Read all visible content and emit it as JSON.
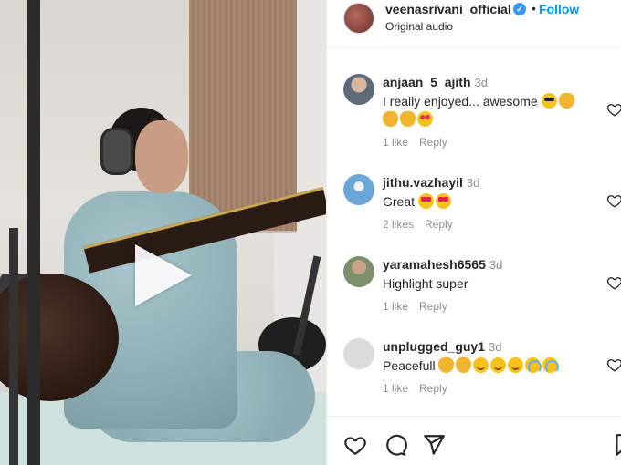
{
  "post": {
    "username": "veenasrivani_official",
    "verified_mark": "✓",
    "separator": "•",
    "follow_label": "Follow",
    "audio_label": "Original audio"
  },
  "comments": [
    {
      "username": "anjaan_5_ajith",
      "time": "3d",
      "text": "I really enjoyed... awesome",
      "emojis": [
        "smiling-face-with-sunglasses",
        "clapping-hands",
        "clapping-hands",
        "clapping-hands",
        "star-struck"
      ],
      "likes": "1 like",
      "reply_label": "Reply"
    },
    {
      "username": "jithu.vazhayil",
      "time": "3d",
      "text": "Great",
      "emojis": [
        "heart-eyes",
        "heart-eyes"
      ],
      "likes": "2 likes",
      "reply_label": "Reply"
    },
    {
      "username": "yaramahesh6565",
      "time": "3d",
      "text": "Highlight super",
      "emojis": [],
      "likes": "1 like",
      "reply_label": "Reply"
    },
    {
      "username": "unplugged_guy1",
      "time": "3d",
      "text": "Peacefull",
      "emojis": [
        "clapping-hands",
        "clapping-hands",
        "smiling-face",
        "smiling-face",
        "smiling-face",
        "grinning-face-with-sweat",
        "grinning-face-with-sweat"
      ],
      "likes": "1 like",
      "reply_label": "Reply"
    }
  ],
  "colors": {
    "accent": "#0095f6",
    "verified": "#3897f0",
    "muted_text": "#8e8e8e",
    "text": "#262626"
  }
}
